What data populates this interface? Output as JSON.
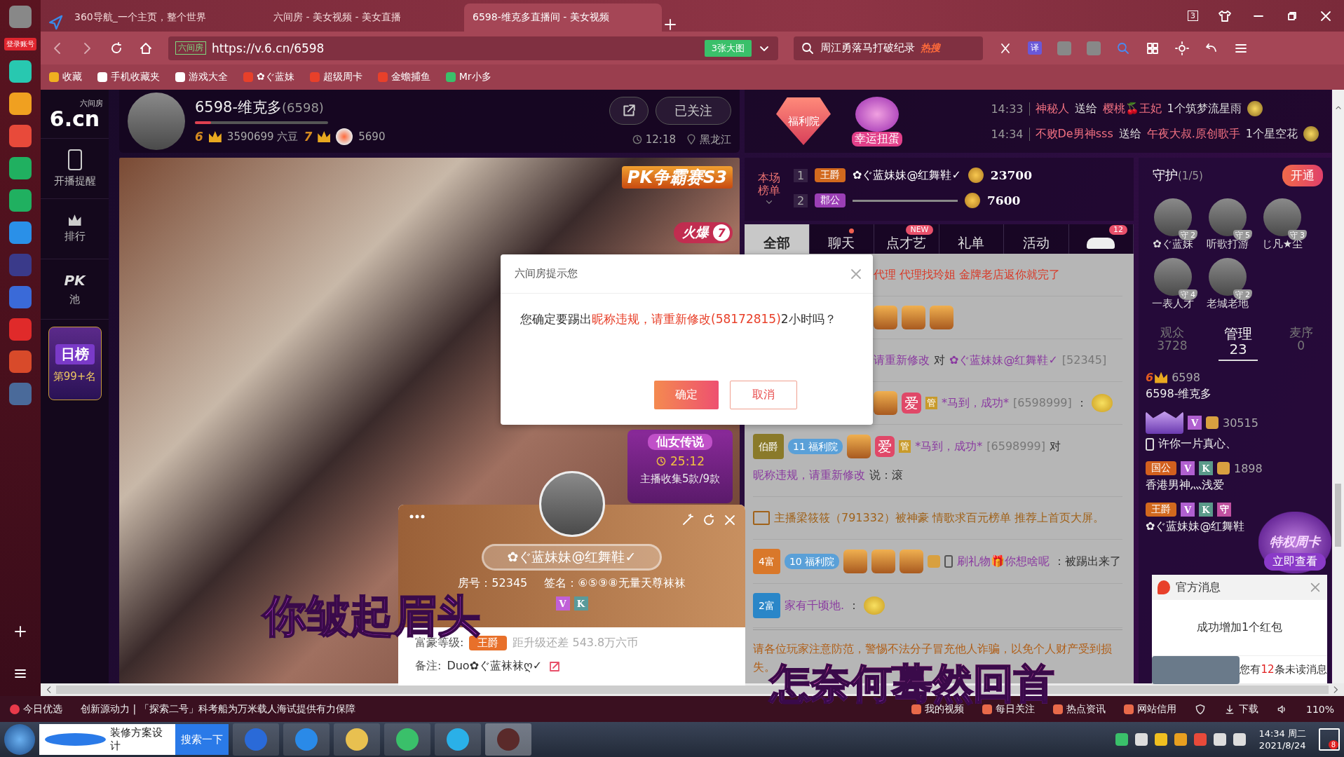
{
  "app_bar": {
    "login": "登录账号"
  },
  "browser": {
    "tabs": [
      {
        "title": "360导航_一个主页，整个世界",
        "selected": false
      },
      {
        "title": "六间房 - 美女视频 - 美女直播",
        "selected": false
      },
      {
        "title": "6598-维克多直播间 - 美女视频",
        "selected": true
      }
    ],
    "tab_count": "3",
    "site_label": "六间房",
    "url": "https://v.6.cn/6598",
    "big_image": "3张大图",
    "search": "周江勇落马打破纪录",
    "search_badge": "热搜",
    "translate": "译"
  },
  "bookmarks": [
    {
      "label": "收藏",
      "kind": "star"
    },
    {
      "label": "手机收藏夹",
      "kind": "phone"
    },
    {
      "label": "游戏大全",
      "kind": "page"
    },
    {
      "label": "✿ぐ蓝妹",
      "kind": "six"
    },
    {
      "label": "超级周卡",
      "kind": "six"
    },
    {
      "label": "金蟾捕鱼",
      "kind": "six"
    },
    {
      "label": "Mr小多",
      "kind": "green"
    }
  ],
  "site_nav": {
    "logo_sub": "六间房",
    "logo": "6.cn",
    "items": [
      {
        "label": "开播提醒",
        "kind": "phone"
      },
      {
        "label": "排行",
        "kind": "crown"
      },
      {
        "label": "池",
        "kind": "pk",
        "mark": "PK"
      }
    ],
    "daily": "日榜",
    "daily_rank": "第99+名"
  },
  "streamer": {
    "name": "6598-维克多",
    "room": "(6598)",
    "level": 0.12,
    "wealth": "6",
    "beans": "3590699 六豆",
    "star": "7",
    "fire": "5690",
    "follow": "已关注",
    "time": "12:18",
    "location": "黑龙江"
  },
  "video": {
    "pk_badge": "PK争霸赛S3",
    "hot": "火爆",
    "hot_count": "7",
    "box_subtitle": "仙女传说",
    "box_timer": "25:12",
    "box_progress": "主播收集5款/9款"
  },
  "promo": {
    "welfare": "福利院",
    "lucky": "幸运扭蛋"
  },
  "gift_feed": [
    {
      "time": "14:33",
      "from": "神秘人",
      "verb": "送给",
      "to": "樱桃🍒王妃",
      "gift": "1个筑梦流星雨"
    },
    {
      "time": "14:34",
      "from": "不败De男神sss",
      "verb": "送给",
      "to": "午夜大叔.原创歌手",
      "gift": "1个星空花"
    }
  ],
  "ranking": {
    "title": "本场榜单",
    "rows": [
      {
        "rank": "1",
        "title": "王爵",
        "color": "#d2691e",
        "name": "✿ぐ蓝妹妹@红舞鞋✓",
        "score": "23700"
      },
      {
        "rank": "2",
        "title": "郡公",
        "color": "#9b3fb5",
        "score": "7600"
      }
    ]
  },
  "chat_tabs": [
    {
      "label": "全部",
      "selected": true,
      "dot": false
    },
    {
      "label": "聊天",
      "selected": false,
      "dot": true
    },
    {
      "label": "点才艺",
      "selected": false,
      "dot": false,
      "badge": "NEW"
    },
    {
      "label": "礼单",
      "selected": false,
      "dot": false
    },
    {
      "label": "活动",
      "selected": false,
      "dot": false
    },
    {
      "kind": "car",
      "selected": false,
      "dot": false,
      "badge": "12"
    }
  ],
  "chat": [
    {
      "kind": "partial",
      "parts": [
        {
          "kind": "red",
          "text": "代理 代理找玲姐 金牌老店返你就完了"
        }
      ]
    },
    {
      "kind": "partial",
      "badges": [
        {
          "kind": "gift"
        },
        {
          "kind": "gift"
        },
        {
          "kind": "gift"
        }
      ]
    },
    {
      "kind": "partial",
      "parts": [
        {
          "kind": "name",
          "text": "请重新修改"
        },
        {
          "kind": "plain",
          "text": "对"
        },
        {
          "kind": "name",
          "text": "✿ぐ蓝妹妹@红舞鞋✓"
        },
        {
          "kind": "id",
          "text": "[52345]"
        }
      ]
    },
    {
      "kind": "partial",
      "badges": [
        {
          "kind": "gift"
        },
        {
          "kind": "love",
          "text": "爱"
        },
        {
          "kind": "admin",
          "text": "管"
        }
      ],
      "parts": [
        {
          "kind": "name",
          "text": "*马到，成功*"
        },
        {
          "kind": "id",
          "text": "[6598999]"
        },
        {
          "kind": "plain",
          "text": "："
        },
        {
          "kind": "emoji"
        }
      ]
    },
    {
      "kind": "full",
      "badges": [
        {
          "kind": "title",
          "text": "伯爵",
          "color": "#8a7a2a"
        },
        {
          "kind": "club",
          "num": "11",
          "text": "福利院"
        },
        {
          "kind": "gift"
        },
        {
          "kind": "love",
          "text": "爱"
        },
        {
          "kind": "admin",
          "text": "管"
        }
      ],
      "parts": [
        {
          "kind": "name",
          "text": "*马到，成功*"
        },
        {
          "kind": "id",
          "text": "[6598999]"
        },
        {
          "kind": "plain",
          "text": "对"
        },
        {
          "kind": "name",
          "text": "昵称违规，请重新修改"
        },
        {
          "kind": "plain",
          "text": "说：滚"
        }
      ]
    },
    {
      "kind": "notice",
      "parts": [
        {
          "kind": "notice",
          "text": "主播梁筱筱（791332）被神豪 情歌求百元榜单 推荐上首页大屏。"
        }
      ]
    },
    {
      "kind": "full",
      "badges": [
        {
          "kind": "title",
          "text": "4富",
          "color": "#d9782a"
        },
        {
          "kind": "club",
          "num": "10",
          "text": "福利院"
        },
        {
          "kind": "gift"
        },
        {
          "kind": "gift"
        },
        {
          "kind": "gift"
        },
        {
          "kind": "user"
        },
        {
          "kind": "phone"
        }
      ],
      "parts": [
        {
          "kind": "name",
          "text": "刷礼物🎁你想啥呢"
        },
        {
          "kind": "plain",
          "text": "：被踢出来了"
        }
      ]
    },
    {
      "kind": "full",
      "badges": [
        {
          "kind": "title",
          "text": "2富",
          "color": "#2a86c8"
        }
      ],
      "parts": [
        {
          "kind": "name",
          "text": "家有千顷地."
        },
        {
          "kind": "plain",
          "text": "："
        },
        {
          "kind": "emoji"
        }
      ]
    }
  ],
  "chat_warning": "请各位玩家注意防范，警惕不法分子冒充他人诈骗，以免个人财产受到损失。",
  "guard": {
    "title": "守护",
    "count": "(1/5)",
    "open": "开通",
    "members": [
      {
        "name": "✿ぐ蓝妹",
        "badge": "守",
        "rank": "2"
      },
      {
        "name": "听歌打游",
        "badge": "守",
        "rank": "5"
      },
      {
        "name": "じ凡★尘",
        "badge": "守",
        "rank": "3"
      },
      {
        "name": "一表人才",
        "badge": "守",
        "rank": "4"
      },
      {
        "name": "老城老地",
        "badge": "守",
        "rank": "2"
      }
    ]
  },
  "audience_tabs": [
    {
      "label": "观众",
      "count": "3728",
      "selected": false
    },
    {
      "label": "管理",
      "count": "23",
      "selected": true
    },
    {
      "label": "麦序",
      "count": "0",
      "selected": false
    }
  ],
  "admins": [
    {
      "badges": [
        {
          "kind": "crown",
          "text": "6"
        }
      ],
      "id": "6598",
      "name": "6598-维克多"
    },
    {
      "badges": [
        {
          "kind": "frame"
        },
        {
          "kind": "vip",
          "text": "V"
        },
        {
          "kind": "user"
        }
      ],
      "id": "30515",
      "phone": true,
      "name": "许你一片真心、"
    },
    {
      "badges": [
        {
          "kind": "title",
          "text": "国公",
          "color": "#d2601e"
        },
        {
          "kind": "vip",
          "text": "V"
        },
        {
          "kind": "k",
          "text": "K"
        },
        {
          "kind": "user"
        }
      ],
      "id": "1898",
      "phone": false,
      "name": "香港男神灬浅爱"
    },
    {
      "badges": [
        {
          "kind": "title",
          "text": "王爵",
          "color": "#d2691e"
        },
        {
          "kind": "vip",
          "text": "V"
        },
        {
          "kind": "k",
          "text": "K"
        },
        {
          "kind": "guard",
          "text": "守"
        }
      ],
      "phone": false,
      "name": "✿ぐ蓝妹妹@红舞鞋"
    }
  ],
  "privilege": {
    "title": "特权周卡",
    "action": "立即查看"
  },
  "official": {
    "title": "官方消息",
    "body": "成功增加1个红包",
    "unread_pre": "您有",
    "unread_count": "12",
    "unread_post": "条未读消息"
  },
  "dialog": {
    "title": "六间房提示您",
    "text_pre": "您确定要踢出",
    "text_highlight": "昵称违规，请重新修改(58172815)",
    "text_post": "2小时吗？",
    "confirm": "确定",
    "cancel": "取消"
  },
  "user_card": {
    "name": "✿ぐ蓝妹妹@红舞鞋✓",
    "room": "房号：52345",
    "sign": "签名：⑥⑤⑨⑧无量天尊袜袜",
    "badges": [
      "V",
      "K"
    ],
    "wealth_label": "富豪等级:",
    "wealth_title": "王爵",
    "upgrade": "距升级还差 543.8万六币",
    "note_label": "备注:",
    "note": "Duo✿ぐ蓝袜袜ღ✓"
  },
  "lyrics": [
    "你皱起眉头",
    "怎奈何蓦然回首"
  ],
  "status_bar": {
    "today": "今日优选",
    "news": "创新源动力 | 「探索二号」科考船为万米载人海试提供有力保障",
    "items": [
      "我的视频",
      "每日关注",
      "热点资讯",
      "网站信用"
    ],
    "download": "下载",
    "zoom": "110%"
  },
  "taskbar": {
    "search_value": "装修方案设计",
    "search_button": "搜索一下",
    "time": "14:34 周二",
    "date": "2021/8/24",
    "notification_count": "8"
  }
}
